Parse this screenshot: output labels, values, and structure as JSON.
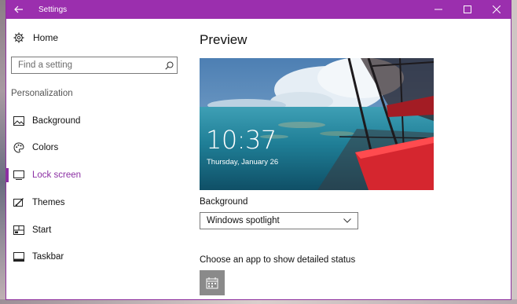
{
  "window": {
    "title": "Settings"
  },
  "sidebar": {
    "home_label": "Home",
    "search_placeholder": "Find a setting",
    "section_label": "Personalization",
    "items": [
      {
        "label": "Background",
        "icon": "picture-icon"
      },
      {
        "label": "Colors",
        "icon": "palette-icon"
      },
      {
        "label": "Lock screen",
        "icon": "lock-screen-icon",
        "active": true
      },
      {
        "label": "Themes",
        "icon": "brush-icon"
      },
      {
        "label": "Start",
        "icon": "start-icon"
      },
      {
        "label": "Taskbar",
        "icon": "taskbar-icon"
      }
    ]
  },
  "main": {
    "preview_title": "Preview",
    "preview_time": "10:37",
    "preview_date": "Thursday, January 26",
    "background_label": "Background",
    "background_value": "Windows spotlight",
    "status_label": "Choose an app to show detailed status"
  },
  "colors": {
    "accent": "#9b2fae",
    "active_text": "#8b2fa3"
  }
}
